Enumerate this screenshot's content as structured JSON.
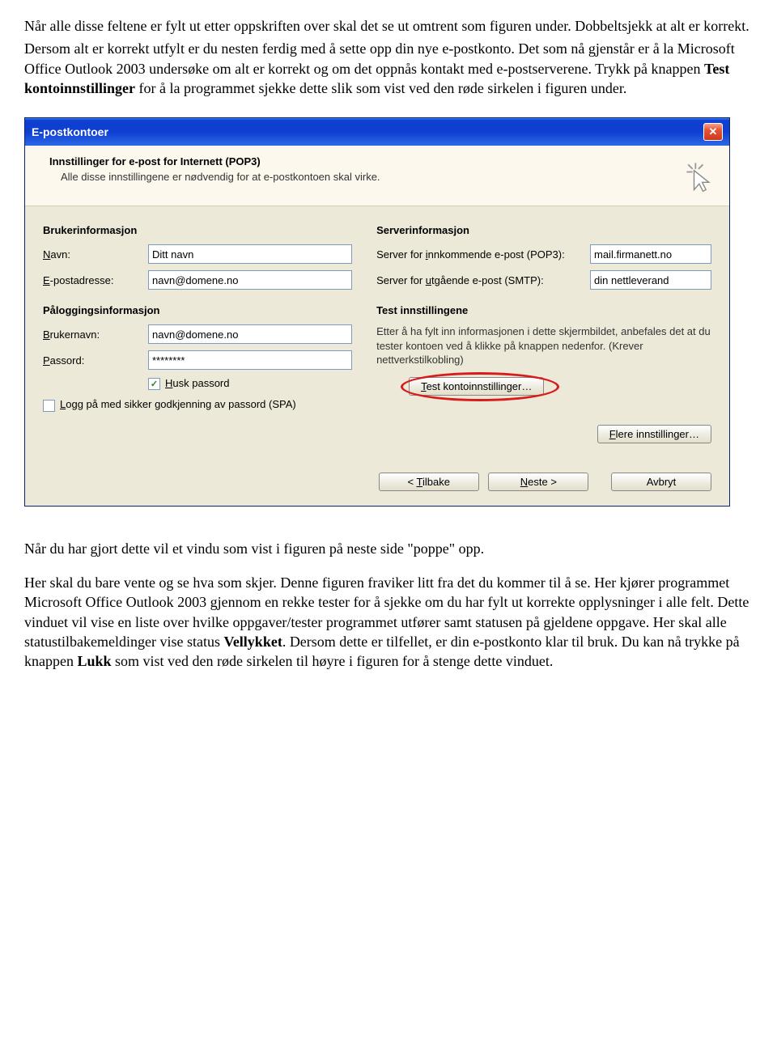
{
  "doc": {
    "p1": "Når alle disse feltene er fylt ut etter oppskriften over skal det se ut omtrent som figuren under. Dobbeltsjekk at alt er korrekt.",
    "p2a": "Dersom alt er korrekt utfylt er du nesten ferdig med å sette opp din nye e-postkonto. Det som nå gjenstår er å la Microsoft Office Outlook 2003 undersøke om alt er korrekt og om det oppnås kontakt med e-postserverene. Trykk på knappen ",
    "p2b": "Test kontoinnstillinger",
    "p2c": " for å la programmet sjekke dette slik som vist ved den røde sirkelen i figuren under.",
    "p3": "Når du har gjort dette vil et vindu som vist i figuren på neste side \"poppe\" opp.",
    "p4a": "Her skal du bare vente og se hva som skjer. Denne figuren fraviker litt fra det du kommer til å se. Her kjører programmet Microsoft Office Outlook 2003 gjennom en rekke tester for å sjekke om du har fylt ut korrekte opplysninger i alle felt. Dette vinduet vil vise en liste over hvilke oppgaver/tester programmet utfører samt statusen på gjeldene oppgave. Her skal alle statustilbakemeldinger vise status ",
    "p4b": "Vellykket",
    "p4c": ". Dersom dette er tilfellet, er din e-postkonto klar til bruk. Du kan nå trykke på knappen ",
    "p4d": "Lukk",
    "p4e": " som vist ved den røde sirkelen til høyre i figuren for å stenge dette vinduet."
  },
  "dialog": {
    "title": "E-postkontoer",
    "header_title": "Innstillinger for e-post for Internett  (POP3)",
    "header_sub": "Alle disse innstillingene er nødvendig for at e-postkontoen skal virke.",
    "user_h": "Brukerinformasjon",
    "server_h": "Serverinformasjon",
    "login_h": "Påloggingsinformasjon",
    "test_h": "Test innstillingene",
    "name_label": "Navn:",
    "name_value": "Ditt navn",
    "email_label": "E-postadresse:",
    "email_value": "navn@domene.no",
    "pop_label": "Server for innkommende e-post (POP3):",
    "pop_value": "mail.firmanett.no",
    "smtp_label": "Server for utgående e-post (SMTP):",
    "smtp_value": "din nettleverand",
    "user_label": "Brukernavn:",
    "user_value": "navn@domene.no",
    "pass_label": "Passord:",
    "pass_value": "********",
    "remember": "Husk passord",
    "spa": "Logg på med sikker godkjenning av passord (SPA)",
    "desc": "Etter å ha fylt inn informasjonen i dette skjermbildet, anbefales det at du tester kontoen ved å klikke på knappen nedenfor. (Krever nettverkstilkobling)",
    "test_btn": "Test kontoinnstillinger…",
    "more_btn": "Flere innstillinger…",
    "back": "< Tilbake",
    "next": "Neste >",
    "cancel": "Avbryt"
  }
}
